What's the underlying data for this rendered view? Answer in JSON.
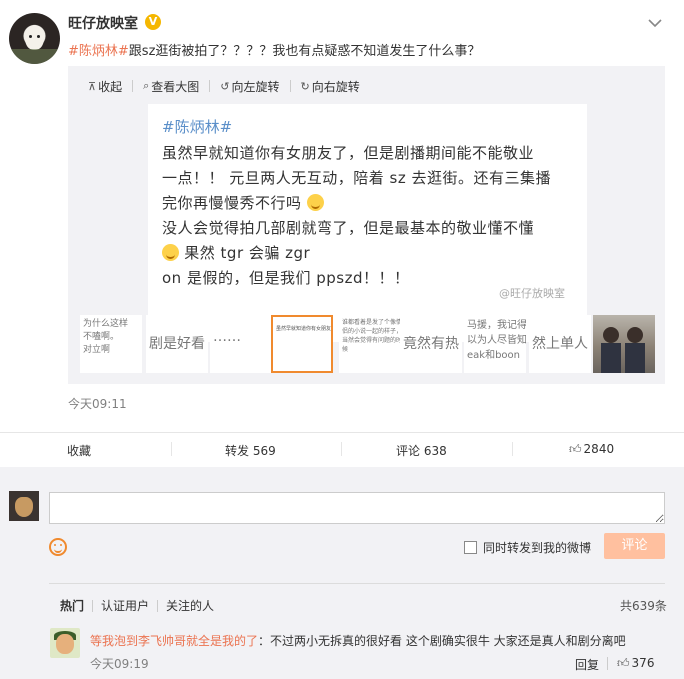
{
  "post": {
    "author": "旺仔放映室",
    "verified_badge": "V",
    "topic_tag": "#陈炳林#",
    "text": "跟sz逛街被拍了？？？？我也有点疑惑不知道发生了什么事？",
    "time": "今天09:11"
  },
  "media": {
    "toolbar": {
      "collapse": "收起",
      "view_large": "查看大图",
      "rotate_left": "向左旋转",
      "rotate_right": "向右旋转"
    },
    "image": {
      "tag": "#陈炳林#",
      "lines": [
        "虽然早就知道你有女朋友了，但是剧播期间能不能敬业",
        "一点！！ 元旦两人无互动，陪着 sz 去逛街。还有三集播",
        "完你再慢慢秀不行吗",
        "没人会觉得拍几部剧就弯了，但是最基本的敬业懂不懂",
        "果然 tgr 会骗 zgr",
        "on 是假的，但是我们 ppszd！！！"
      ],
      "watermark": "@旺仔放映室"
    },
    "thumbnails": [
      {
        "text": "为什么这样\n不嗑啊。\n对立啊"
      },
      {
        "text": "剧是好看"
      },
      {
        "text": "……"
      },
      {
        "text": "虽然早就知道你有女朋友了，但是剧播期间能不能敬业一点！！元旦两人无互动，陪着sz去逛街。果然tgr会骗zgr on是假的，但是我们ppszd"
      },
      {
        "text": "谁都看着是发了个像情侣的小说一起的样子，当然会觉得有问题的时候"
      },
      {
        "text": "竟然有热"
      },
      {
        "text": "马援，我记得\n以为人尽皆知\neak和boon"
      },
      {
        "text": "然上单人"
      },
      {
        "text": ""
      }
    ]
  },
  "actions": {
    "favorite": "收藏",
    "repost": "转发 569",
    "comment": "评论 638",
    "like": "2840"
  },
  "compose": {
    "placeholder": "",
    "repost_checkbox_label": "同时转发到我的微博",
    "submit_label": "评论"
  },
  "comments_header": {
    "tabs": [
      "热门",
      "认证用户",
      "关注的人"
    ],
    "total": "共639条"
  },
  "comments": [
    {
      "user": "等我泡到李飞帅哥就全是我的了",
      "text": "：不过两小无拆真的很好看 这个剧确实很牛 大家还是真人和剧分离吧",
      "time": "今天09:19",
      "reply": "回复",
      "likes": "376"
    }
  ],
  "colors": {
    "accent": "#eb7350",
    "topic_blue": "#5b8fc9",
    "submit_disabled": "#ffc09f",
    "selected_thumb_border": "#f08a2e"
  }
}
